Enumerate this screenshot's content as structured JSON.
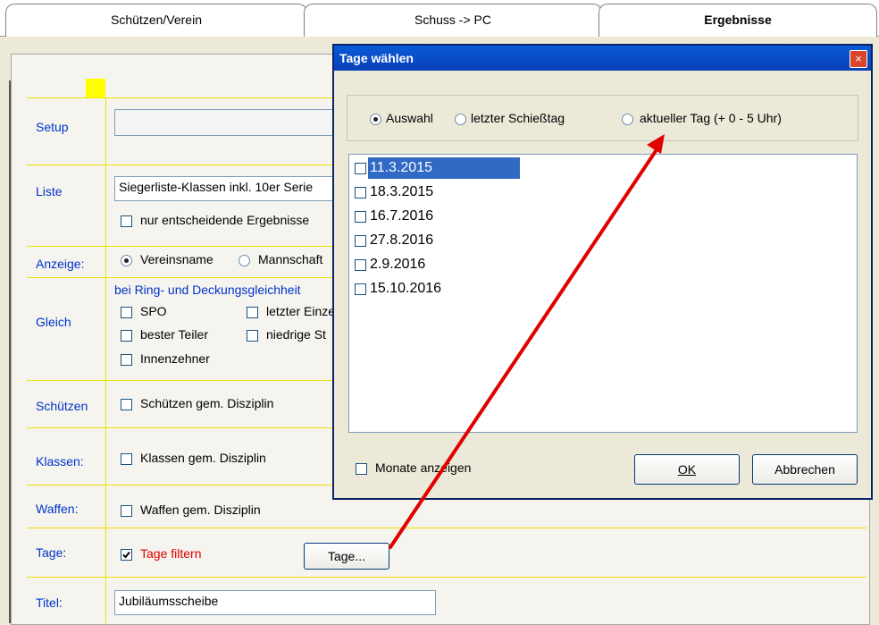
{
  "tabs": [
    {
      "label": "Schützen/Verein"
    },
    {
      "label": "Schuss -> PC"
    },
    {
      "label": "Ergebnisse"
    }
  ],
  "form": {
    "setup_label": "Setup",
    "setup_value": "",
    "liste_label": "Liste",
    "liste_value": "Siegerliste-Klassen inkl. 10er Serie",
    "nur_entscheidende": "nur entscheidende Ergebnisse",
    "anzeige_label": "Anzeige:",
    "anzeige_opt1": "Vereinsname",
    "anzeige_opt2": "Mannschaft",
    "gleich_hint": "bei Ring- und Deckungsgleichheit",
    "gleich_label": "Gleich",
    "spo": "SPO",
    "letzter_einzel": "letzter Einzel",
    "bester_teiler": "bester Teiler",
    "niedrige": "niedrige St",
    "innenzehner": "Innenzehner",
    "schuetzen_label": "Schützen",
    "schuetzen_cb": "Schützen gem. Disziplin",
    "klassen_label": "Klassen:",
    "klassen_cb": "Klassen gem. Disziplin",
    "waffen_label": "Waffen:",
    "waffen_cb": "Waffen gem. Disziplin",
    "tage_label": "Tage:",
    "tage_filtern": "Tage filtern",
    "tage_button": "Tage...",
    "titel_label": "Titel:",
    "titel_value": "Jubiläumsscheibe"
  },
  "dialog": {
    "title": "Tage wählen",
    "close": "×",
    "radio_auswahl": "Auswahl",
    "radio_letzter": "letzter Schießtag",
    "radio_aktueller": "aktueller Tag (+ 0 - 5 Uhr)",
    "dates": [
      "11.3.2015",
      "18.3.2015",
      "16.7.2016",
      "27.8.2016",
      "2.9.2016",
      "15.10.2016"
    ],
    "monate": "Monate anzeigen",
    "ok": "OK",
    "abbrechen": "Abbrechen"
  },
  "colors": {
    "label_blue": "#0033cc",
    "accent_red": "#e00000",
    "title_blue": "#0a5ad8",
    "selection": "#316ac5"
  }
}
